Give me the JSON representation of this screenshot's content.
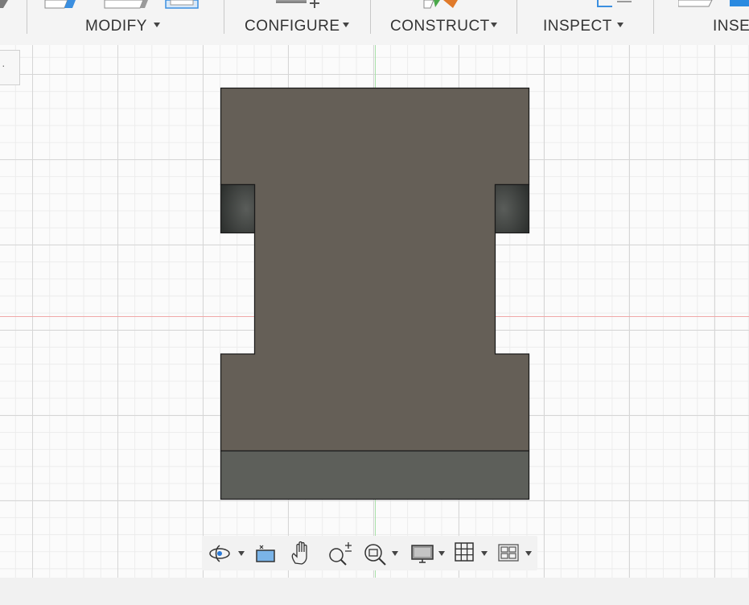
{
  "toolbar": {
    "groups": [
      {
        "label": "MODIFY"
      },
      {
        "label": "CONFIGURE"
      },
      {
        "label": "CONSTRUCT"
      },
      {
        "label": "INSPECT"
      },
      {
        "label": "INSE"
      }
    ]
  },
  "viewport": {
    "grid": "on",
    "colors": {
      "body_face": "#655f57",
      "recess_face": "#3f4240",
      "bottom_face": "#5d5f5a",
      "x_axis": "#f0a8a8",
      "y_axis": "#a8e0a8"
    }
  },
  "navigation_bar": {
    "items": [
      {
        "icon": "orbit-icon",
        "has_dropdown": true
      },
      {
        "icon": "look-at-icon",
        "has_dropdown": false
      },
      {
        "icon": "pan-hand-icon",
        "has_dropdown": false
      },
      {
        "icon": "zoom-icon",
        "has_dropdown": false
      },
      {
        "icon": "zoom-window-icon",
        "has_dropdown": true
      },
      {
        "icon": "display-settings-icon",
        "has_dropdown": true
      },
      {
        "icon": "grid-settings-icon",
        "has_dropdown": true
      },
      {
        "icon": "viewports-icon",
        "has_dropdown": true
      }
    ]
  }
}
